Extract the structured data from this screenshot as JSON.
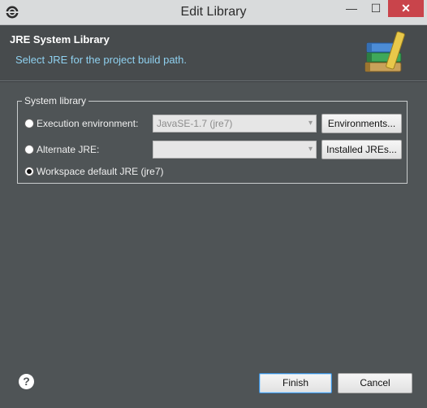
{
  "window": {
    "title": "Edit Library",
    "min_glyph": "—",
    "max_glyph": "☐",
    "close_glyph": "✕"
  },
  "header": {
    "title": "JRE System Library",
    "subtitle": "Select JRE for the project build path."
  },
  "group": {
    "label": "System library",
    "options": [
      {
        "label": "Execution environment:",
        "selected": false,
        "combo_value": "JavaSE-1.7 (jre7)",
        "button": "Environments..."
      },
      {
        "label": "Alternate JRE:",
        "selected": false,
        "combo_value": "",
        "button": "Installed JREs..."
      },
      {
        "label": "Workspace default JRE (jre7)",
        "selected": true
      }
    ]
  },
  "footer": {
    "help_glyph": "?",
    "finish": "Finish",
    "cancel": "Cancel"
  },
  "colors": {
    "dialog_bg": "#4f5456",
    "header_bg": "#474b4d",
    "subtitle": "#8fd1f0",
    "close_button": "#c9444b"
  }
}
